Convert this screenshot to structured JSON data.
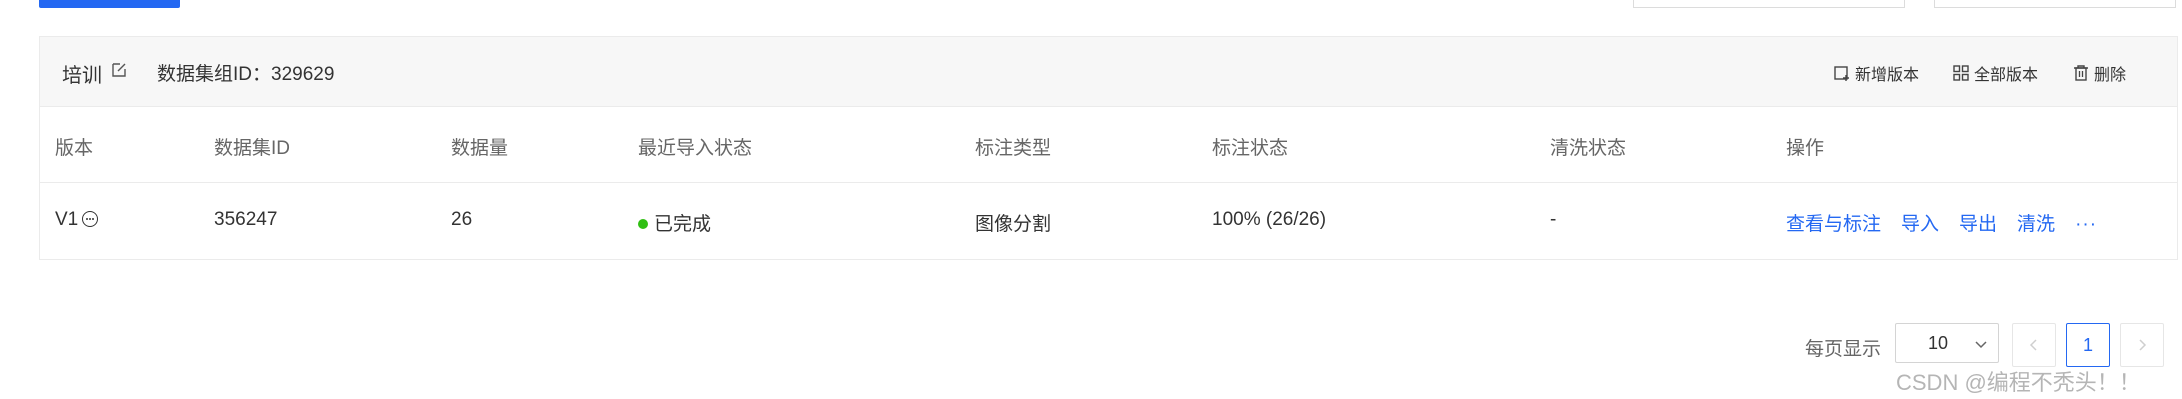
{
  "group": {
    "title": "培训",
    "id_text": "数据集组ID：329629",
    "actions": {
      "new_version": "新增版本",
      "all_versions": "全部版本",
      "delete": "删除"
    }
  },
  "table": {
    "columns": [
      "版本",
      "数据集ID",
      "数据量",
      "最近导入状态",
      "标注类型",
      "标注状态",
      "清洗状态",
      "操作"
    ],
    "rows": [
      {
        "version": "V1",
        "dataset_id": "356247",
        "count": "26",
        "import_status": "已完成",
        "label_type": "图像分割",
        "label_status": "100% (26/26)",
        "clean_status": "-",
        "ops": [
          "查看与标注",
          "导入",
          "导出",
          "清洗"
        ],
        "more": "···"
      }
    ]
  },
  "pagination": {
    "label": "每页显示",
    "page_size": "10",
    "current_page": "1"
  },
  "watermark": "CSDN @编程不秃头！！",
  "colors": {
    "accent": "#2468f2",
    "status_success": "#30bf13",
    "header_bg": "#f7f7f7"
  },
  "icons": {
    "edit": "edit-icon",
    "new_version": "add-version-icon",
    "all_versions": "grid-icon",
    "delete": "trash-icon",
    "version_more": "more-circle-icon",
    "select_arrow": "chevron-down-icon",
    "prev": "chevron-left-icon",
    "next": "chevron-right-icon"
  }
}
